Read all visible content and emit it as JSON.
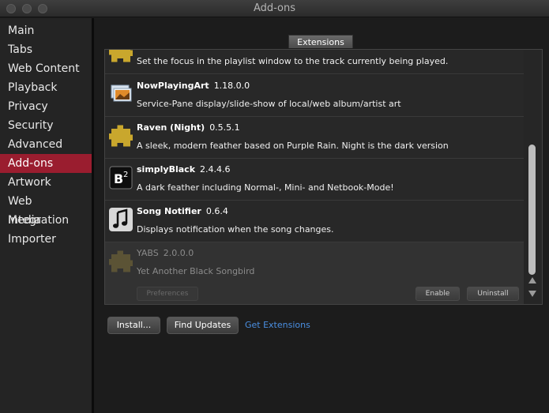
{
  "window": {
    "title": "Add-ons"
  },
  "sidebar": {
    "items": [
      {
        "label": "Main"
      },
      {
        "label": "Tabs"
      },
      {
        "label": "Web Content"
      },
      {
        "label": "Playback"
      },
      {
        "label": "Privacy"
      },
      {
        "label": "Security"
      },
      {
        "label": "Advanced"
      },
      {
        "label": "Add-ons",
        "active": true
      },
      {
        "label": "Artwork"
      },
      {
        "label": "Web Integration"
      },
      {
        "label": "Media Importer"
      }
    ]
  },
  "main": {
    "tab_label": "Extensions",
    "extensions": [
      {
        "name": "",
        "version": "",
        "description": "Set the focus in the playlist window to the track currently being played.",
        "icon": "puzzle-icon"
      },
      {
        "name": "NowPlayingArt",
        "version": "1.18.0.0",
        "description": "Service-Pane display/slide-show of local/web album/artist art",
        "icon": "image-icon"
      },
      {
        "name": "Raven (Night)",
        "version": "0.5.5.1",
        "description": "A sleek, modern feather based on Purple Rain. Night is the dark version",
        "icon": "puzzle-icon"
      },
      {
        "name": "simplyBlack",
        "version": "2.4.4.6",
        "description": "A dark feather including Normal-, Mini- and Netbook-Mode!",
        "icon": "b2-icon"
      },
      {
        "name": "Song Notifier",
        "version": "0.6.4",
        "description": "Displays notification when the song changes.",
        "icon": "music-note-icon"
      },
      {
        "name": "YABS",
        "version": "2.0.0.0",
        "description": "Yet Another Black Songbird",
        "icon": "puzzle-icon",
        "disabled": true,
        "buttons": {
          "preferences": "Preferences",
          "enable": "Enable",
          "uninstall": "Uninstall"
        }
      }
    ],
    "footer": {
      "install": "Install...",
      "find_updates": "Find Updates",
      "get_extensions": "Get Extensions"
    }
  },
  "colors": {
    "accent": "#9a1d2f",
    "link": "#4a8fe2"
  }
}
